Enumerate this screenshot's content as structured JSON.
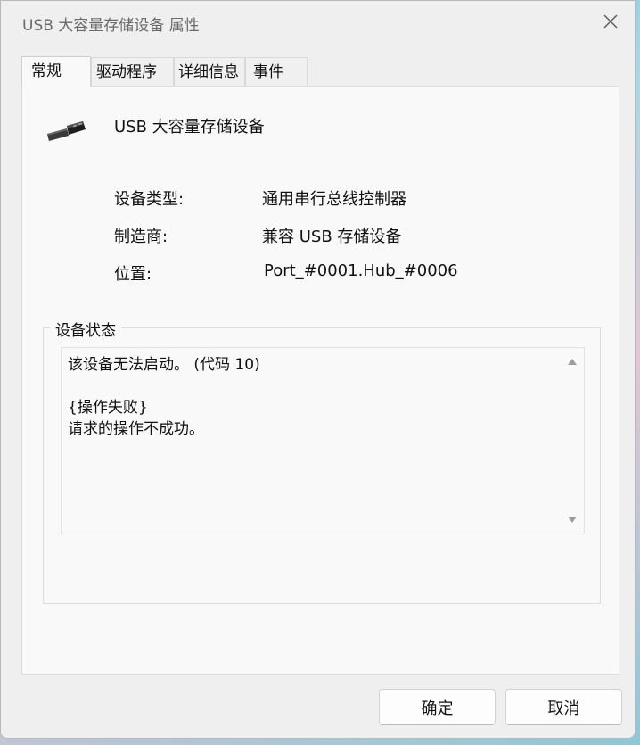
{
  "window": {
    "title": "USB 大容量存储设备 属性"
  },
  "tabs": [
    {
      "label": "常规",
      "active": true
    },
    {
      "label": "驱动程序",
      "active": false
    },
    {
      "label": "详细信息",
      "active": false
    },
    {
      "label": "事件",
      "active": false
    }
  ],
  "device": {
    "icon": "usb-plug-icon",
    "name": "USB 大容量存储设备"
  },
  "properties": {
    "type_label": "设备类型:",
    "type_value": "通用串行总线控制器",
    "manufacturer_label": "制造商:",
    "manufacturer_value": "兼容 USB 存储设备",
    "location_label": "位置:",
    "location_value": "Port_#0001.Hub_#0006"
  },
  "status": {
    "group_label": "设备状态",
    "text": "该设备无法启动。 (代码 10)\n\n{操作失败}\n请求的操作不成功。"
  },
  "buttons": {
    "ok": "确定",
    "cancel": "取消"
  }
}
